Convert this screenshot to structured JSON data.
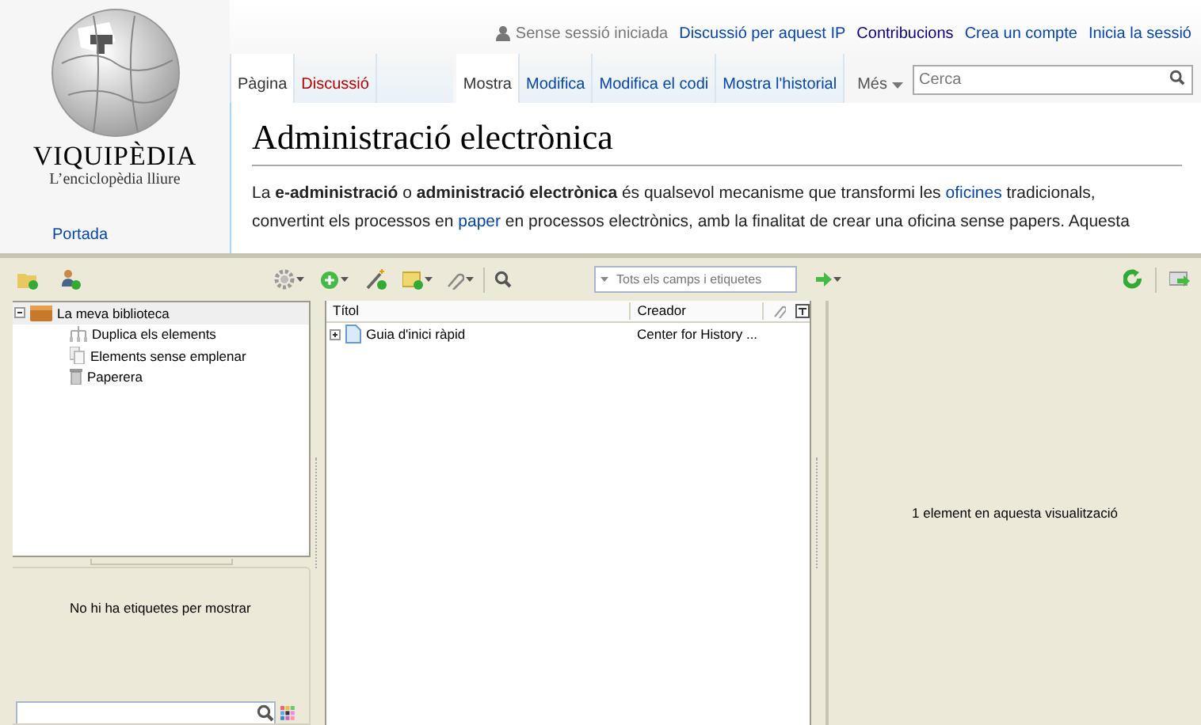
{
  "wiki": {
    "personal_bar": {
      "status": "Sense sessió iniciada",
      "links": [
        {
          "label": "Discussió per aquest IP",
          "visited": false
        },
        {
          "label": "Contribucions",
          "visited": true
        },
        {
          "label": "Crea un compte",
          "visited": false
        },
        {
          "label": "Inicia la sessió",
          "visited": false
        }
      ]
    },
    "logo": {
      "wordmark": "VIQUIPÈDIA",
      "tagline": "L’enciclopèdia lliure"
    },
    "sidebar_links": [
      "Portada"
    ],
    "namespace_tabs": [
      {
        "label": "Pàgina",
        "selected": true,
        "missing": false
      },
      {
        "label": "Discussió",
        "selected": false,
        "missing": true
      }
    ],
    "view_tabs": [
      {
        "label": "Mostra",
        "selected": true
      },
      {
        "label": "Modifica",
        "selected": false
      },
      {
        "label": "Modifica el codi",
        "selected": false
      },
      {
        "label": "Mostra l'historial",
        "selected": false
      }
    ],
    "more_menu": {
      "label": "Més"
    },
    "search": {
      "placeholder": "Cerca"
    },
    "article": {
      "title": "Administració electrònica",
      "intro": [
        {
          "text": "La **e-administració** o **administració electrònica** és qualsevol mecanisme que transformi les ",
          "kind": "text"
        },
        {
          "text": "oficines",
          "kind": "link"
        },
        {
          "text": " tradicionals, convertint els processos en ",
          "kind": "text"
        },
        {
          "text": "paper",
          "kind": "link"
        },
        {
          "text": " en processos electrònics, amb la finalitat de crear una oficina sense papers. Aquesta",
          "kind": "text"
        }
      ]
    }
  },
  "zotero": {
    "search": {
      "placeholder": "Tots els camps i etiquetes"
    },
    "collections": [
      {
        "label": "La meva biblioteca",
        "kind": "library",
        "expanded": true,
        "children": [
          {
            "label": "Duplica els elements",
            "kind": "duplicates"
          },
          {
            "label": "Elements sense emplenar",
            "kind": "unfiled"
          },
          {
            "label": "Paperera",
            "kind": "trash"
          }
        ]
      }
    ],
    "tags": {
      "empty_message": "No hi ha etiquetes per mostrar"
    },
    "items": {
      "columns": [
        "Títol",
        "Creador"
      ],
      "rows": [
        {
          "title": "Guia d'inici ràpid",
          "creator": "Center for History ...",
          "expanded": false
        }
      ]
    },
    "item_pane": {
      "message": "1 element en aquesta visualització"
    }
  }
}
